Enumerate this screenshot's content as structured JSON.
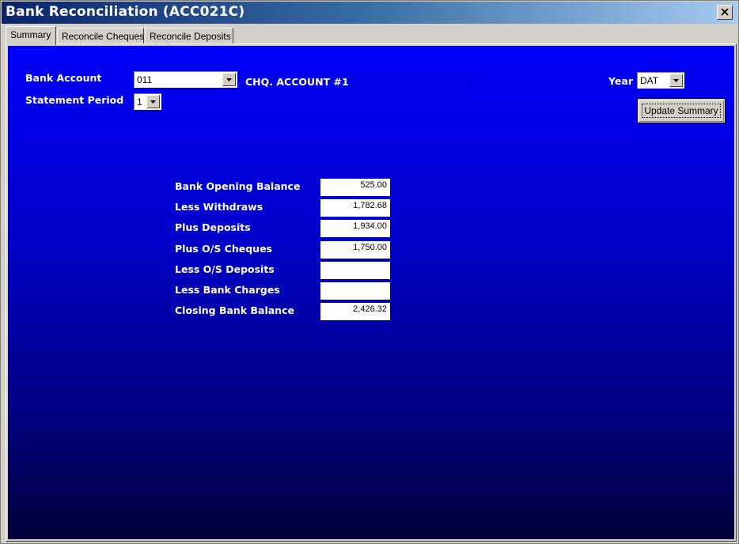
{
  "window": {
    "title": "Bank Reconciliation (ACC021C)"
  },
  "tabs": [
    {
      "label": "Summary",
      "active": true
    },
    {
      "label": "Reconcile Cheques",
      "active": false
    },
    {
      "label": "Reconcile Deposits",
      "active": false
    }
  ],
  "form": {
    "bank_account_label": "Bank Account",
    "bank_account_value": "011",
    "bank_account_name": "CHQ. ACCOUNT #1",
    "statement_period_label": "Statement Period",
    "statement_period_value": "1",
    "year_label": "Year",
    "year_value": "DAT",
    "update_button": "Update Summary"
  },
  "summary": [
    {
      "label": "Bank Opening Balance",
      "value": "525.00"
    },
    {
      "label": "Less Withdraws",
      "value": "1,782.68"
    },
    {
      "label": "Plus Deposits",
      "value": "1,934.00"
    },
    {
      "label": "Plus O/S Cheques",
      "value": "1,750.00"
    },
    {
      "label": "Less O/S Deposits",
      "value": ""
    },
    {
      "label": "Less Bank Charges",
      "value": ""
    },
    {
      "label": "Closing Bank Balance",
      "value": "2,426.32"
    }
  ],
  "colors": {
    "content_top": "#0000f8",
    "content_bottom": "#00003a",
    "title_gradient_start": "#0a246a"
  }
}
